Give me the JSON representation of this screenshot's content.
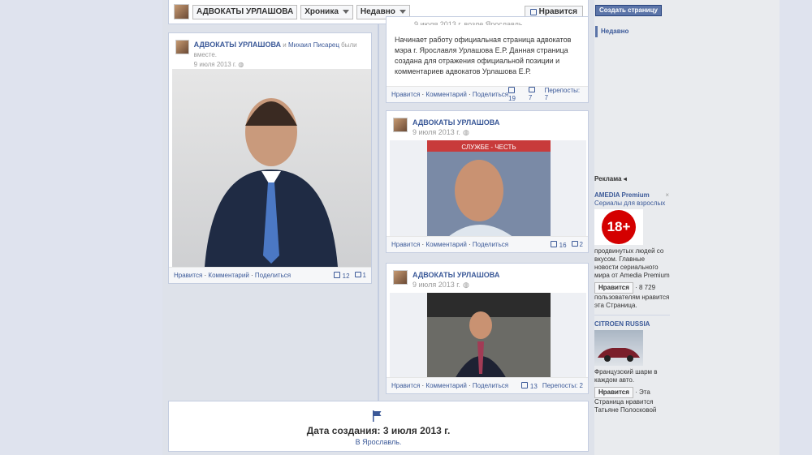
{
  "topbar": {
    "page_name": "АДВОКАТЫ УРЛАШОВА",
    "timeline_label": "Хроника",
    "sort_label": "Недавно",
    "like_label": "Нравится"
  },
  "post_left": {
    "author": "АДВОКАТЫ УРЛАШОВА",
    "conj": "и",
    "with": "Михаил Писарец",
    "tail": "были вместе.",
    "date": "9 июля 2013 г.",
    "actions": [
      "Нравится",
      "Комментарий",
      "Поделиться"
    ],
    "likes": "12",
    "comments": "1"
  },
  "post_text": {
    "header_partial": "9 июля 2013 г. возле Ярославль",
    "body": "Начинает работу официальная страница адвокатов мэра г. Ярославля Урлашова Е.Р. Данная страница создана для отражения официальной позиции и комментариев адвокатов Урлашова Е.Р.",
    "actions": [
      "Нравится",
      "Комментарий",
      "Поделиться"
    ],
    "likes": "19",
    "comments": "7",
    "shares": "Перепосты: 7"
  },
  "post_photo2": {
    "author": "АДВОКАТЫ УРЛАШОВА",
    "date": "9 июля 2013 г.",
    "actions": [
      "Нравится",
      "Комментарий",
      "Поделиться"
    ],
    "likes": "16",
    "comments": "2",
    "sign": "СЛУЖБЕ - ЧЕСТЬ"
  },
  "post_photo3": {
    "author": "АДВОКАТЫ УРЛАШОВА",
    "date": "9 июля 2013 г.",
    "actions": [
      "Нравится",
      "Комментарий",
      "Поделиться"
    ],
    "likes": "13",
    "shares": "Перепосты: 2"
  },
  "created": {
    "title": "Дата создания: 3 июля 2013 г.",
    "place": "В Ярославль."
  },
  "right": {
    "create_page": "Создать страницу",
    "recent": "Недавно",
    "ads_label": "Реклама",
    "ad1": {
      "title": "AMEDIA Premium",
      "sub": "Сериалы для взрослых",
      "badge": "18+",
      "text": "продвинутых людей со вкусом. Главные новости сериального мира от Amedia Premium",
      "like": "Нравится",
      "count": "· 8 729",
      "count_text": "пользователям нравится эта Страница."
    },
    "ad2": {
      "title": "CITROEN RUSSIA",
      "text": "Французский шарм в каждом авто.",
      "like": "Нравится",
      "tail": "· Эта",
      "likers": "Страница нравится Татьяне Полосковой"
    }
  },
  "colors": {
    "link": "#3b5998",
    "accent": "#5b74a8",
    "bg": "#e9ebee"
  }
}
